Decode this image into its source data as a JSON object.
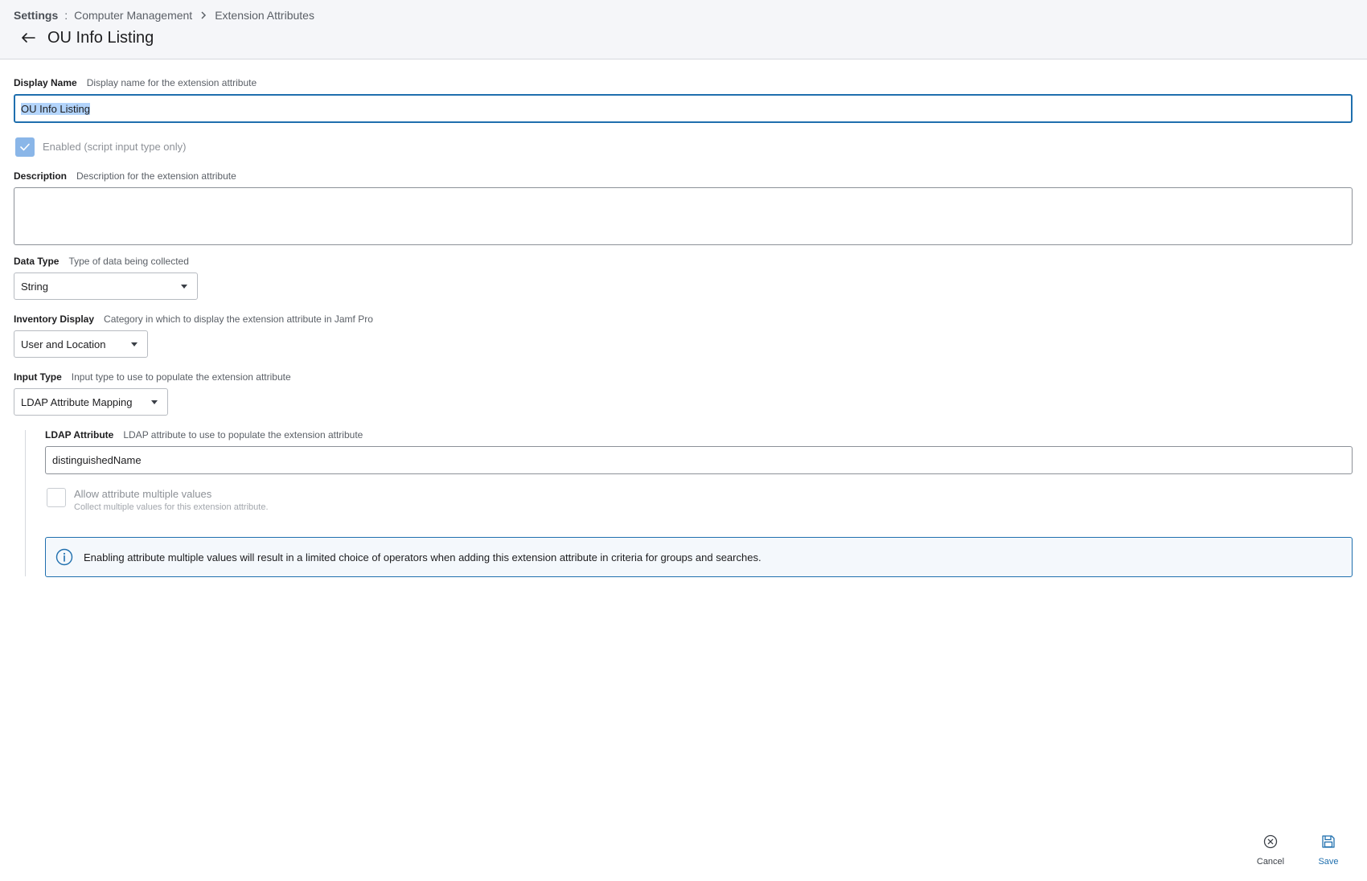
{
  "breadcrumb": {
    "root": "Settings",
    "separator": ":",
    "items": [
      "Computer Management",
      "Extension Attributes"
    ]
  },
  "page": {
    "title": "OU Info Listing"
  },
  "display_name": {
    "label": "Display Name",
    "hint": "Display name for the extension attribute",
    "value": "OU Info Listing"
  },
  "enabled": {
    "label": "Enabled (script input type only)",
    "checked": true
  },
  "description": {
    "label": "Description",
    "hint": "Description for the extension attribute",
    "value": ""
  },
  "data_type": {
    "label": "Data Type",
    "hint": "Type of data being collected",
    "selected": "String"
  },
  "inventory_display": {
    "label": "Inventory Display",
    "hint": "Category in which to display the extension attribute in Jamf Pro",
    "selected": "User and Location"
  },
  "input_type": {
    "label": "Input Type",
    "hint": "Input type to use to populate the extension attribute",
    "selected": "LDAP Attribute Mapping"
  },
  "ldap_attribute": {
    "label": "LDAP Attribute",
    "hint": "LDAP attribute to use to populate the extension attribute",
    "value": "distinguishedName"
  },
  "multiple_values": {
    "label": "Allow attribute multiple values",
    "sublabel": "Collect multiple values for this extension attribute.",
    "checked": false
  },
  "info": {
    "text": "Enabling attribute multiple values will result in a limited choice of operators when adding this extension attribute in criteria for groups and searches."
  },
  "actions": {
    "cancel": "Cancel",
    "save": "Save"
  },
  "colors": {
    "accent": "#1f6fae",
    "selection": "#b3d4fb",
    "checkbox_checked": "#8ab6e8"
  },
  "icons": {
    "back": "arrow-left-icon",
    "chevron": "chevron-right-icon",
    "info": "info-circle-icon",
    "cancel": "close-circle-icon",
    "save": "floppy-disk-icon",
    "check": "check-icon",
    "dropdown": "caret-down-icon"
  }
}
